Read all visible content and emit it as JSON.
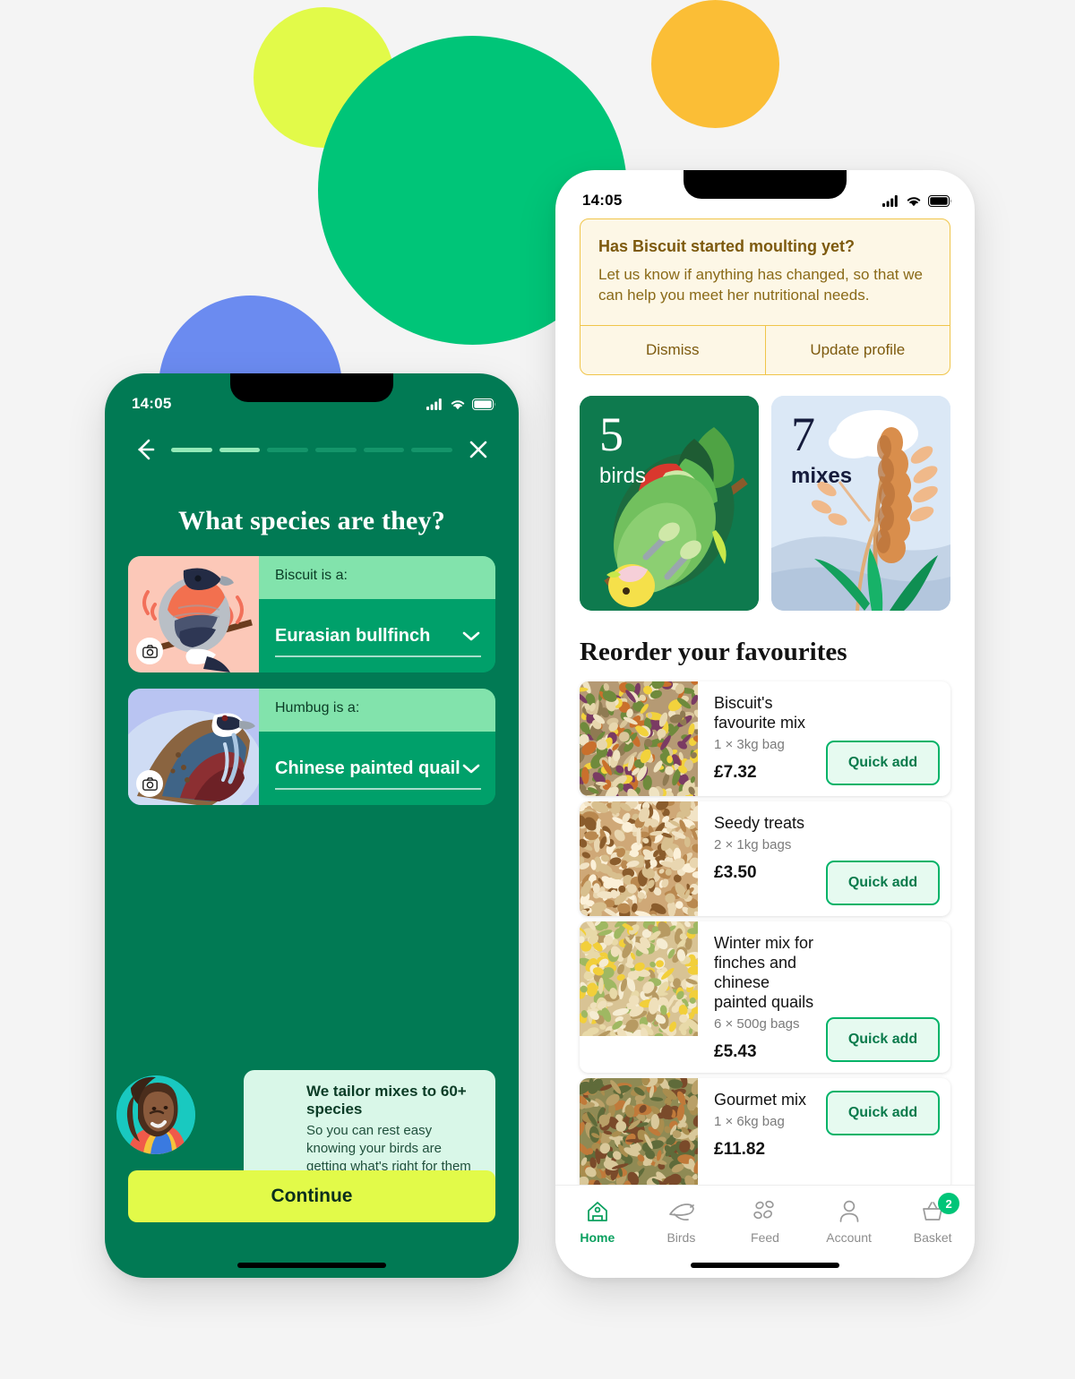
{
  "background": {
    "page_color": "#f4f4f4",
    "blobs": [
      {
        "name": "green-circle",
        "color": "#00c578"
      },
      {
        "name": "lime-circle",
        "color": "#e2fa49"
      },
      {
        "name": "amber-circle",
        "color": "#fbbe36"
      },
      {
        "name": "blue-circle",
        "color": "#6b8bf0"
      }
    ]
  },
  "onboarding_phone": {
    "status_bar": {
      "time": "14:05",
      "cellular": "signal-icon",
      "wifi": "wifi-icon",
      "battery": "battery-icon"
    },
    "nav": {
      "back_icon": "arrow-left-icon",
      "close_icon": "close-icon",
      "progress_total": 6,
      "progress_done": 2
    },
    "title": "What species are they?",
    "birds": [
      {
        "label": "Biscuit is a:",
        "species": "Eurasian bullfinch",
        "thumb_name": "bullfinch-illustration",
        "camera_icon": "camera-icon",
        "chevron_icon": "chevron-down-icon"
      },
      {
        "label": "Humbug is a:",
        "species": "Chinese painted quail",
        "thumb_name": "quail-illustration",
        "camera_icon": "camera-icon",
        "chevron_icon": "chevron-down-icon"
      }
    ],
    "tailor_card": {
      "avatar_name": "customer-avatar",
      "title": "We tailor mixes to 60+ species",
      "subtitle": "So you can rest easy knowing your birds are getting what's right for them"
    },
    "continue_label": "Continue",
    "colors": {
      "bg": "#017a54",
      "card": "#00a06a",
      "label": "#82e3ac",
      "cta": "#e2fa49"
    }
  },
  "home_phone": {
    "status_bar": {
      "time": "14:05",
      "cellular": "signal-icon",
      "wifi": "wifi-icon",
      "battery": "battery-icon"
    },
    "alert": {
      "title": "Has Biscuit started moulting yet?",
      "body": "Let us know if anything has changed, so that we can help you meet her nutritional needs.",
      "dismiss_label": "Dismiss",
      "update_label": "Update profile",
      "bg": "#fdf7e6",
      "border": "#f0c54a",
      "text": "#8a6a18"
    },
    "stats": [
      {
        "number": "5",
        "label": "birds",
        "illustration": "parrot-illustration",
        "bg": "#0e7a4e"
      },
      {
        "number": "7",
        "label": "mixes",
        "illustration": "wheat-illustration",
        "bg": "#dbe8f6"
      }
    ],
    "section_title": "Reorder your favourites",
    "quick_add_label": "Quick add",
    "products": [
      {
        "name": "Biscuit's favourite mix",
        "qty": "1 × 3kg bag",
        "price": "£7.32",
        "thumb_name": "seed-mix-photo-1",
        "button_align": "bottom"
      },
      {
        "name": "Seedy treats",
        "qty": "2 × 1kg bags",
        "price": "£3.50",
        "thumb_name": "seed-mix-photo-2",
        "button_align": "bottom"
      },
      {
        "name": "Winter mix for finches and chinese painted quails",
        "qty": "6 × 500g bags",
        "price": "£5.43",
        "thumb_name": "seed-mix-photo-3",
        "button_align": "bottom"
      },
      {
        "name": "Gourmet mix",
        "qty": "1 × 6kg bag",
        "price": "£11.82",
        "thumb_name": "seed-mix-photo-4",
        "button_align": "top"
      }
    ],
    "tabs": [
      {
        "label": "Home",
        "icon": "home-icon",
        "active": true,
        "badge": null
      },
      {
        "label": "Birds",
        "icon": "bird-icon",
        "active": false,
        "badge": null
      },
      {
        "label": "Feed",
        "icon": "seeds-icon",
        "active": false,
        "badge": null
      },
      {
        "label": "Account",
        "icon": "person-icon",
        "active": false,
        "badge": null
      },
      {
        "label": "Basket",
        "icon": "basket-icon",
        "active": false,
        "badge": "2"
      }
    ],
    "accent": "#00b368"
  }
}
